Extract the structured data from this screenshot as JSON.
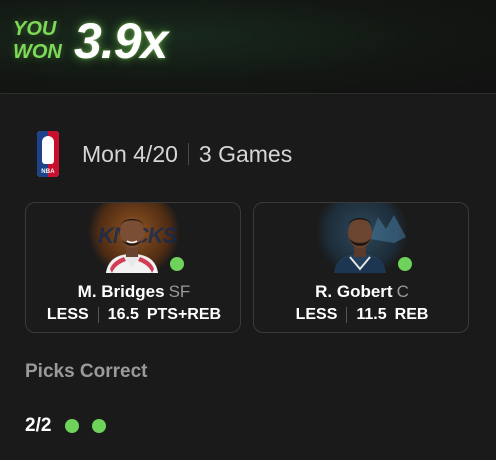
{
  "result": {
    "you_won_label_line1": "YOU",
    "you_won_label_line2": "WON",
    "multiplier": "3.9x"
  },
  "slate": {
    "league_logo": "nba-logo",
    "league_logo_text": "NBA",
    "date": "Mon 4/20",
    "games": "3 Games"
  },
  "picks": [
    {
      "player": "M. Bridges",
      "position": "SF",
      "direction": "LESS",
      "line": "16.5",
      "stat": "PTS+REB",
      "team_mark": "KNICKS",
      "result_icon": "check-dot-icon"
    },
    {
      "player": "R. Gobert",
      "position": "C",
      "direction": "LESS",
      "line": "11.5",
      "stat": "REB",
      "result_icon": "check-dot-icon"
    }
  ],
  "summary": {
    "label": "Picks Correct",
    "count": "2/2",
    "correct_dots": 2
  },
  "colors": {
    "accent_green": "#7ed957",
    "dot_green": "#6fd35b",
    "background": "#1a1a1a",
    "card_border": "#3a3a3a",
    "muted_text": "#9a9a9a"
  }
}
